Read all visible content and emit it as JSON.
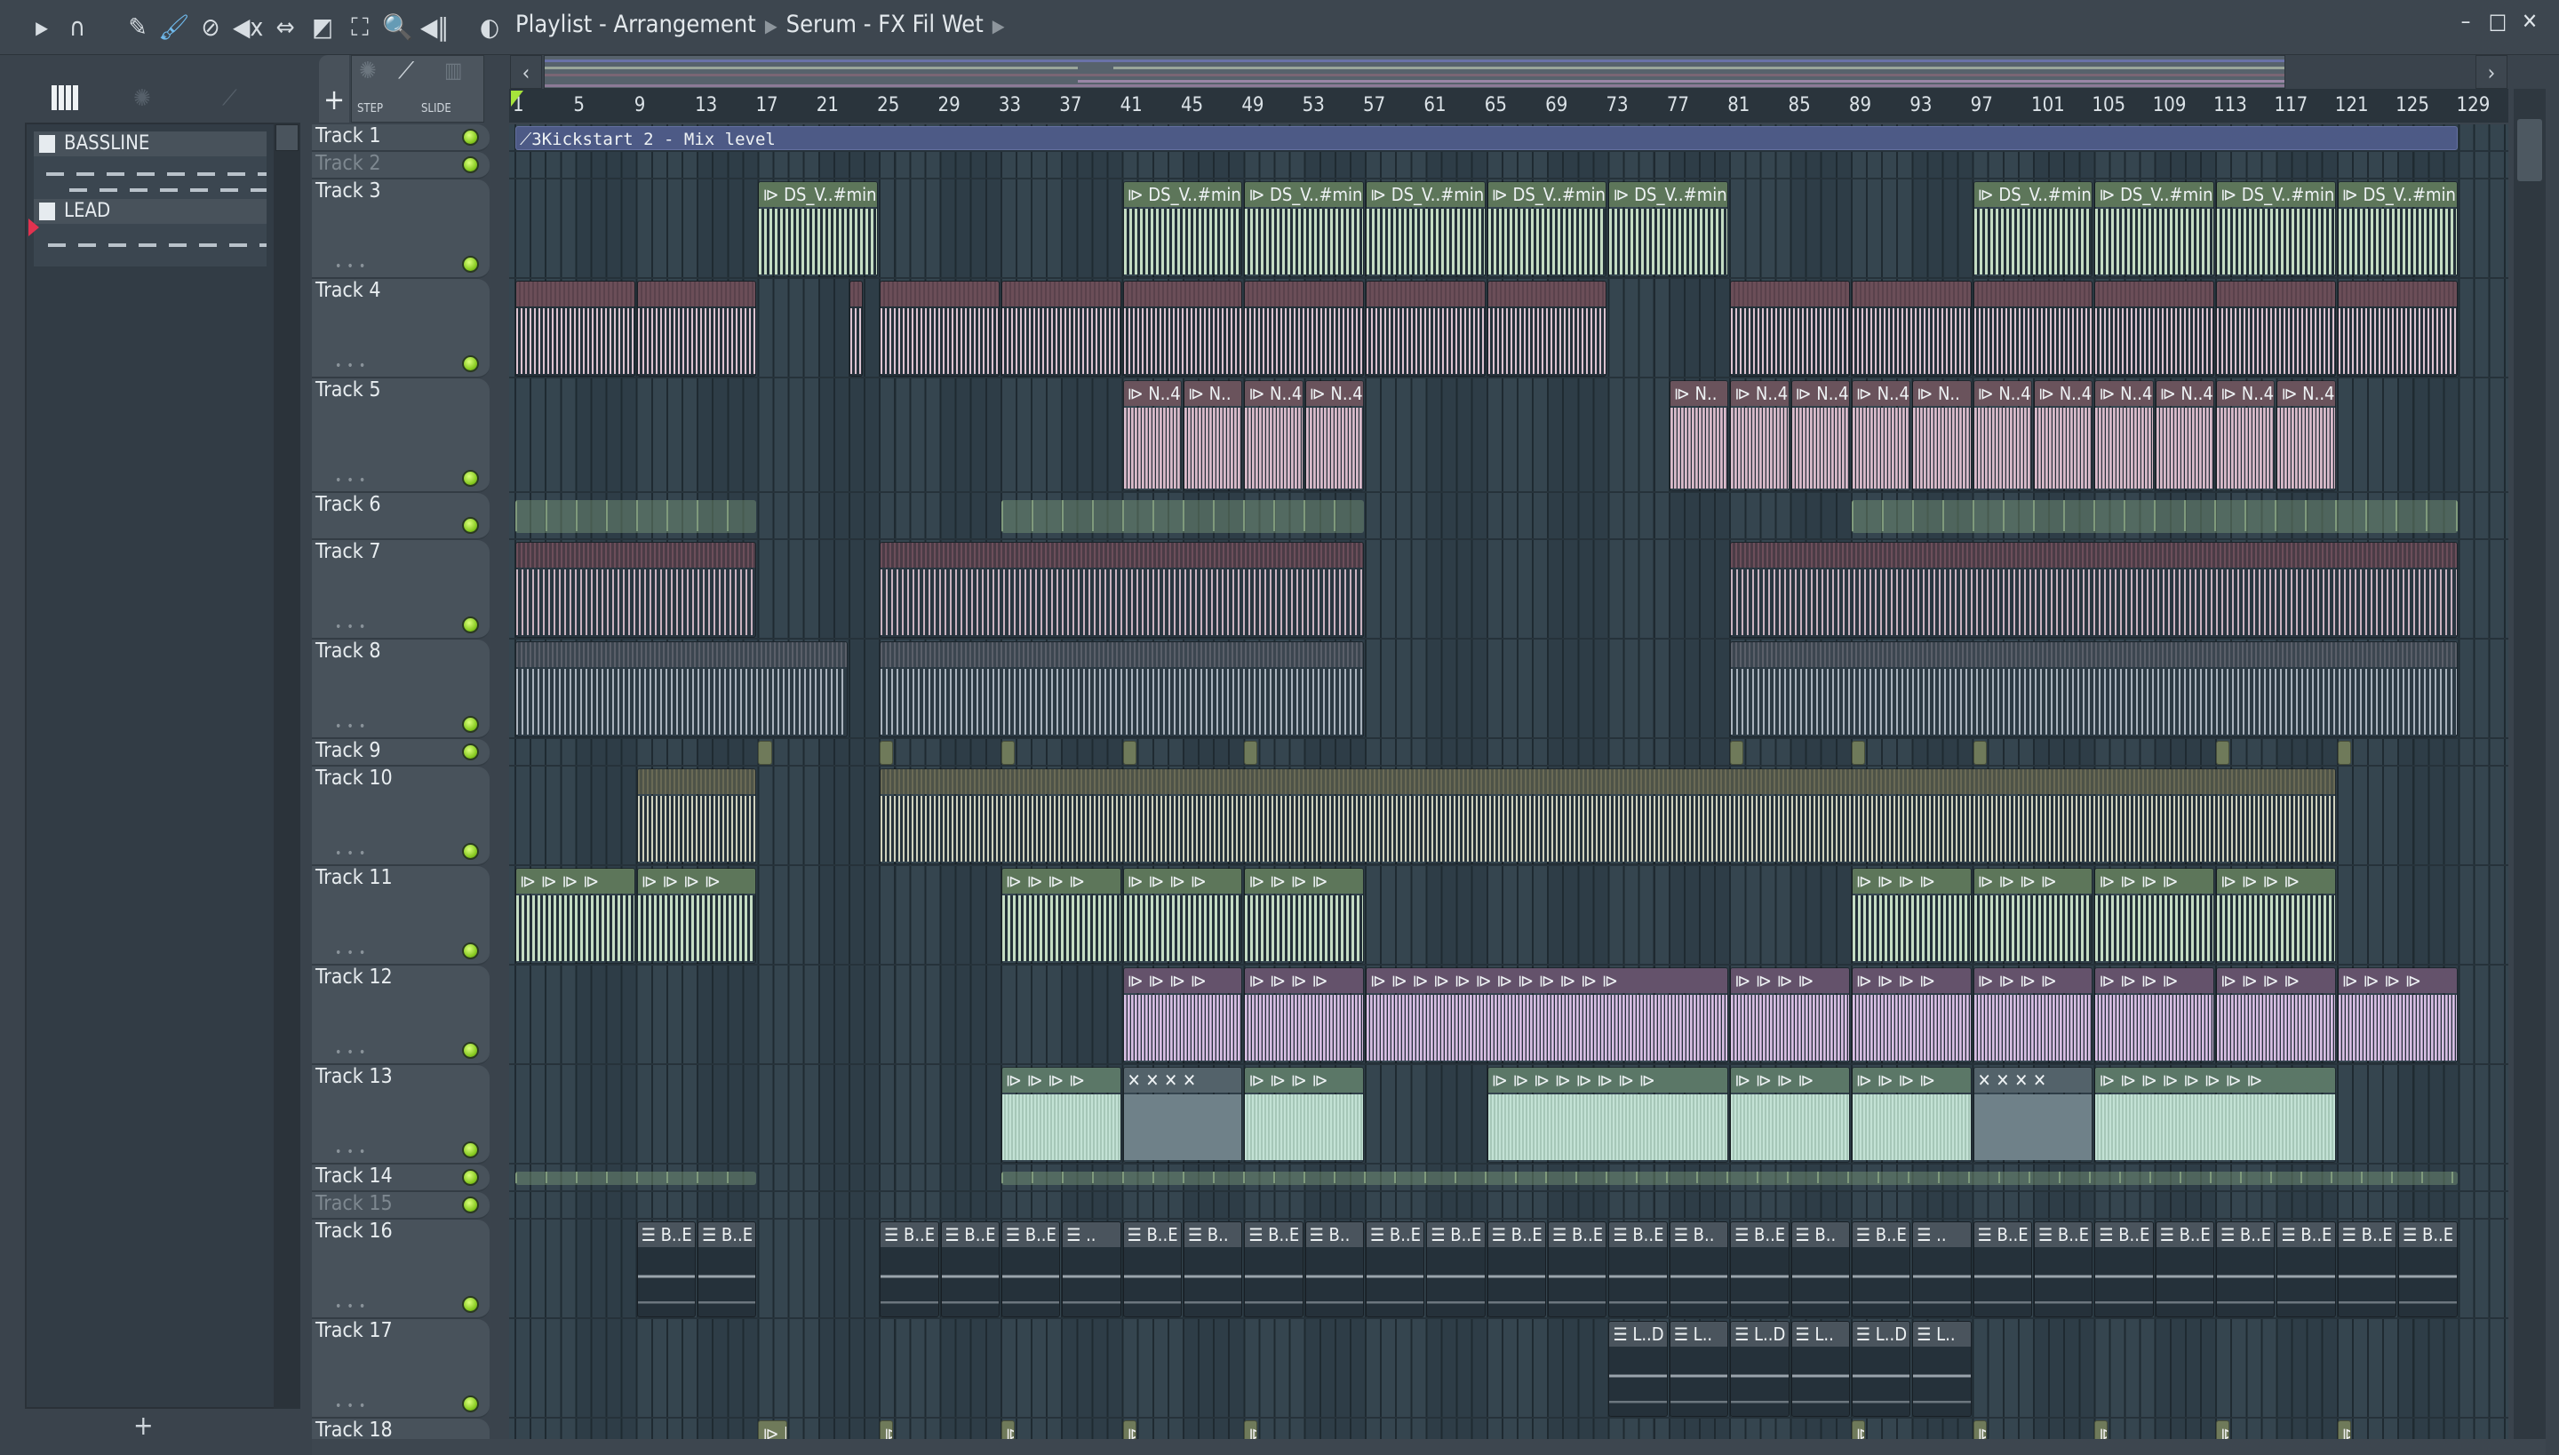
{
  "toolbar": {
    "icons": [
      "play-arrow-icon",
      "magnet-icon",
      "pencil-icon",
      "paint-brush-icon",
      "delete-icon",
      "mute-icon",
      "slip-icon",
      "slice-icon",
      "select-icon",
      "zoom-icon",
      "playback-icon"
    ],
    "speaker_icon": "speaker-icon",
    "breadcrumb": [
      "Playlist - Arrangement",
      "Serum - FX Fil Wet"
    ]
  },
  "window_controls": {
    "minimize": "–",
    "maximize": "□",
    "close": "✕"
  },
  "channel_panel": {
    "channels": [
      {
        "label": "BASSLINE"
      },
      {
        "label": "LEAD"
      }
    ],
    "add_label": "+"
  },
  "playlist_tools": {
    "add_label": "+",
    "step_label": "STEP",
    "slide_label": "SLIDE"
  },
  "ruler": {
    "labels": [
      "1",
      "5",
      "9",
      "13",
      "17",
      "21",
      "25",
      "29",
      "33",
      "37",
      "41",
      "45",
      "49",
      "53",
      "57",
      "61",
      "65",
      "69",
      "73",
      "77",
      "81",
      "85",
      "89",
      "93",
      "97",
      "101",
      "105",
      "109",
      "113",
      "117",
      "121",
      "125",
      "129",
      "1"
    ]
  },
  "tracks": [
    {
      "name": "Track 1"
    },
    {
      "name": "Track 2",
      "muted": true
    },
    {
      "name": "Track 3"
    },
    {
      "name": "Track 4"
    },
    {
      "name": "Track 5"
    },
    {
      "name": "Track 6"
    },
    {
      "name": "Track 7"
    },
    {
      "name": "Track 8"
    },
    {
      "name": "Track 9"
    },
    {
      "name": "Track 10"
    },
    {
      "name": "Track 11"
    },
    {
      "name": "Track 12"
    },
    {
      "name": "Track 13"
    },
    {
      "name": "Track 14"
    },
    {
      "name": "Track 15",
      "muted": true
    },
    {
      "name": "Track 16"
    },
    {
      "name": "Track 17"
    },
    {
      "name": "Track 18"
    }
  ],
  "clips": [
    {
      "track": 1,
      "start": 1,
      "len": 128,
      "label": "⟋3Kickstart 2 - Mix level",
      "style": "auto"
    },
    {
      "track": 3,
      "start": 17,
      "len": 8,
      "label": "⧐ DS_V..#min",
      "style": "green"
    },
    {
      "track": 3,
      "start": 41,
      "len": 8,
      "label": "⧐ DS_V..#min",
      "style": "green"
    },
    {
      "track": 3,
      "start": 49,
      "len": 8,
      "label": "⧐ DS_V..#min",
      "style": "green"
    },
    {
      "track": 3,
      "start": 57,
      "len": 8,
      "label": "⧐ DS_V..#min",
      "style": "green"
    },
    {
      "track": 3,
      "start": 65,
      "len": 8,
      "label": "⧐ DS_V..#min",
      "style": "green"
    },
    {
      "track": 3,
      "start": 73,
      "len": 8,
      "label": "⧐ DS_V..#min",
      "style": "green"
    },
    {
      "track": 3,
      "start": 97,
      "len": 8,
      "label": "⧐ DS_V..#min",
      "style": "green"
    },
    {
      "track": 3,
      "start": 105,
      "len": 8,
      "label": "⧐ DS_V..#min",
      "style": "green"
    },
    {
      "track": 3,
      "start": 113,
      "len": 8,
      "label": "⧐ DS_V..#min",
      "style": "green"
    },
    {
      "track": 3,
      "start": 121,
      "len": 8,
      "label": "⧐ DS_V..#min",
      "style": "green"
    },
    {
      "track": 4,
      "start": 1,
      "len": 8,
      "label": "",
      "style": "pink"
    },
    {
      "track": 4,
      "start": 9,
      "len": 8,
      "label": "",
      "style": "pink"
    },
    {
      "track": 4,
      "start": 23,
      "len": 1,
      "label": "",
      "style": "pink"
    },
    {
      "track": 4,
      "start": 25,
      "len": 8,
      "label": "",
      "style": "pink"
    },
    {
      "track": 4,
      "start": 33,
      "len": 8,
      "label": "",
      "style": "pink"
    },
    {
      "track": 4,
      "start": 41,
      "len": 8,
      "label": "",
      "style": "pink"
    },
    {
      "track": 4,
      "start": 49,
      "len": 8,
      "label": "",
      "style": "pink"
    },
    {
      "track": 4,
      "start": 57,
      "len": 8,
      "label": "",
      "style": "pink"
    },
    {
      "track": 4,
      "start": 65,
      "len": 8,
      "label": "",
      "style": "pink"
    },
    {
      "track": 4,
      "start": 81,
      "len": 8,
      "label": "",
      "style": "pink"
    },
    {
      "track": 4,
      "start": 89,
      "len": 8,
      "label": "",
      "style": "pink"
    },
    {
      "track": 4,
      "start": 97,
      "len": 8,
      "label": "",
      "style": "pink"
    },
    {
      "track": 4,
      "start": 105,
      "len": 8,
      "label": "",
      "style": "pink"
    },
    {
      "track": 4,
      "start": 113,
      "len": 8,
      "label": "",
      "style": "pink"
    },
    {
      "track": 4,
      "start": 121,
      "len": 8,
      "label": "",
      "style": "pink"
    },
    {
      "track": 5,
      "start": 41,
      "len": 4,
      "label": "⧐ N..4",
      "style": "npink"
    },
    {
      "track": 5,
      "start": 45,
      "len": 4,
      "label": "⧐ N..",
      "style": "npink"
    },
    {
      "track": 5,
      "start": 49,
      "len": 4,
      "label": "⧐ N..4",
      "style": "npink"
    },
    {
      "track": 5,
      "start": 53,
      "len": 4,
      "label": "⧐ N..4",
      "style": "npink"
    },
    {
      "track": 5,
      "start": 77,
      "len": 4,
      "label": "⧐ N..",
      "style": "npink"
    },
    {
      "track": 5,
      "start": 81,
      "len": 4,
      "label": "⧐ N..4",
      "style": "npink"
    },
    {
      "track": 5,
      "start": 85,
      "len": 4,
      "label": "⧐ N..4",
      "style": "npink"
    },
    {
      "track": 5,
      "start": 89,
      "len": 4,
      "label": "⧐ N..4",
      "style": "npink"
    },
    {
      "track": 5,
      "start": 93,
      "len": 4,
      "label": "⧐ N..",
      "style": "npink"
    },
    {
      "track": 5,
      "start": 97,
      "len": 4,
      "label": "⧐ N..4",
      "style": "npink"
    },
    {
      "track": 5,
      "start": 101,
      "len": 4,
      "label": "⧐ N..4",
      "style": "npink"
    },
    {
      "track": 5,
      "start": 105,
      "len": 4,
      "label": "⧐ N..4",
      "style": "npink"
    },
    {
      "track": 5,
      "start": 109,
      "len": 4,
      "label": "⧐ N..4",
      "style": "npink"
    },
    {
      "track": 5,
      "start": 113,
      "len": 4,
      "label": "⧐ N..4",
      "style": "npink"
    },
    {
      "track": 5,
      "start": 117,
      "len": 4,
      "label": "⧐ N..4",
      "style": "npink"
    },
    {
      "track": 6,
      "start": 1,
      "len": 16,
      "label": "",
      "style": "tick"
    },
    {
      "track": 6,
      "start": 33,
      "len": 24,
      "label": "",
      "style": "tick"
    },
    {
      "track": 6,
      "start": 89,
      "len": 40,
      "label": "",
      "style": "tick"
    },
    {
      "track": 7,
      "start": 1,
      "len": 16,
      "label": "",
      "style": "stripe"
    },
    {
      "track": 7,
      "start": 25,
      "len": 32,
      "label": "",
      "style": "stripe"
    },
    {
      "track": 7,
      "start": 81,
      "len": 48,
      "label": "",
      "style": "stripe"
    },
    {
      "track": 8,
      "start": 1,
      "len": 22,
      "label": "",
      "style": "gray"
    },
    {
      "track": 8,
      "start": 25,
      "len": 32,
      "label": "",
      "style": "gray"
    },
    {
      "track": 8,
      "start": 81,
      "len": 48,
      "label": "",
      "style": "gray"
    },
    {
      "track": 9,
      "start": 17,
      "len": 1,
      "label": "",
      "style": "mark"
    },
    {
      "track": 9,
      "start": 25,
      "len": 1,
      "label": "",
      "style": "mark"
    },
    {
      "track": 9,
      "start": 33,
      "len": 1,
      "label": "",
      "style": "mark"
    },
    {
      "track": 9,
      "start": 41,
      "len": 1,
      "label": "",
      "style": "mark"
    },
    {
      "track": 9,
      "start": 49,
      "len": 1,
      "label": "",
      "style": "mark"
    },
    {
      "track": 9,
      "start": 81,
      "len": 1,
      "label": "",
      "style": "mark"
    },
    {
      "track": 9,
      "start": 89,
      "len": 1,
      "label": "",
      "style": "mark"
    },
    {
      "track": 9,
      "start": 97,
      "len": 1,
      "label": "",
      "style": "mark"
    },
    {
      "track": 9,
      "start": 113,
      "len": 1,
      "label": "",
      "style": "mark"
    },
    {
      "track": 9,
      "start": 121,
      "len": 1,
      "label": "",
      "style": "mark"
    },
    {
      "track": 10,
      "start": 9,
      "len": 8,
      "label": "",
      "style": "olive"
    },
    {
      "track": 10,
      "start": 25,
      "len": 96,
      "label": "",
      "style": "olive"
    },
    {
      "track": 11,
      "start": 1,
      "len": 8,
      "label": "⧐ ⧐ ⧐ ⧐",
      "style": "green"
    },
    {
      "track": 11,
      "start": 9,
      "len": 8,
      "label": "⧐ ⧐ ⧐ ⧐",
      "style": "green"
    },
    {
      "track": 11,
      "start": 33,
      "len": 8,
      "label": "⧐ ⧐ ⧐ ⧐",
      "style": "green"
    },
    {
      "track": 11,
      "start": 41,
      "len": 8,
      "label": "⧐ ⧐ ⧐ ⧐",
      "style": "green"
    },
    {
      "track": 11,
      "start": 49,
      "len": 8,
      "label": "⧐ ⧐ ⧐ ⧐",
      "style": "green"
    },
    {
      "track": 11,
      "start": 89,
      "len": 8,
      "label": "⧐ ⧐ ⧐ ⧐",
      "style": "green"
    },
    {
      "track": 11,
      "start": 97,
      "len": 8,
      "label": "⧐ ⧐ ⧐ ⧐",
      "style": "green"
    },
    {
      "track": 11,
      "start": 105,
      "len": 8,
      "label": "⧐ ⧐ ⧐ ⧐",
      "style": "green"
    },
    {
      "track": 11,
      "start": 113,
      "len": 8,
      "label": "⧐ ⧐ ⧐ ⧐",
      "style": "green"
    },
    {
      "track": 12,
      "start": 41,
      "len": 8,
      "label": "⧐ ⧐ ⧐ ⧐",
      "style": "purple"
    },
    {
      "track": 12,
      "start": 49,
      "len": 8,
      "label": "⧐ ⧐ ⧐ ⧐",
      "style": "purple"
    },
    {
      "track": 12,
      "start": 57,
      "len": 24,
      "label": "⧐ ⧐ ⧐ ⧐ ⧐ ⧐ ⧐ ⧐ ⧐ ⧐ ⧐ ⧐",
      "style": "purple"
    },
    {
      "track": 12,
      "start": 81,
      "len": 8,
      "label": "⧐ ⧐ ⧐ ⧐",
      "style": "purple"
    },
    {
      "track": 12,
      "start": 89,
      "len": 8,
      "label": "⧐ ⧐ ⧐ ⧐",
      "style": "purple"
    },
    {
      "track": 12,
      "start": 97,
      "len": 8,
      "label": "⧐ ⧐ ⧐ ⧐",
      "style": "purple"
    },
    {
      "track": 12,
      "start": 105,
      "len": 8,
      "label": "⧐ ⧐ ⧐ ⧐",
      "style": "purple"
    },
    {
      "track": 12,
      "start": 113,
      "len": 8,
      "label": "⧐ ⧐ ⧐ ⧐",
      "style": "purple"
    },
    {
      "track": 12,
      "start": 121,
      "len": 8,
      "label": "⧐ ⧐ ⧐ ⧐",
      "style": "purple"
    },
    {
      "track": 13,
      "start": 33,
      "len": 8,
      "label": "⧐ ⧐ ⧐ ⧐",
      "style": "teal"
    },
    {
      "track": 13,
      "start": 41,
      "len": 8,
      "label": "✕ ✕ ✕ ✕",
      "style": "tealx"
    },
    {
      "track": 13,
      "start": 49,
      "len": 8,
      "label": "⧐ ⧐ ⧐ ⧐",
      "style": "teal"
    },
    {
      "track": 13,
      "start": 65,
      "len": 16,
      "label": "⧐ ⧐ ⧐ ⧐ ⧐ ⧐ ⧐ ⧐",
      "style": "teal"
    },
    {
      "track": 13,
      "start": 81,
      "len": 8,
      "label": "⧐ ⧐ ⧐ ⧐",
      "style": "teal"
    },
    {
      "track": 13,
      "start": 89,
      "len": 8,
      "label": "⧐ ⧐ ⧐ ⧐",
      "style": "teal"
    },
    {
      "track": 13,
      "start": 97,
      "len": 8,
      "label": "✕ ✕ ✕ ✕",
      "style": "tealx"
    },
    {
      "track": 13,
      "start": 105,
      "len": 16,
      "label": "⧐ ⧐ ⧐ ⧐ ⧐ ⧐ ⧐ ⧐",
      "style": "teal"
    },
    {
      "track": 14,
      "start": 1,
      "len": 16,
      "label": "",
      "style": "tick"
    },
    {
      "track": 14,
      "start": 33,
      "len": 96,
      "label": "",
      "style": "tick"
    },
    {
      "track": 16,
      "start": 9,
      "len": 4,
      "label": "☰ B..E",
      "style": "pat"
    },
    {
      "track": 16,
      "start": 13,
      "len": 4,
      "label": "☰ B..E",
      "style": "pat"
    },
    {
      "track": 16,
      "start": 25,
      "len": 4,
      "label": "☰ B..E",
      "style": "pat"
    },
    {
      "track": 16,
      "start": 29,
      "len": 4,
      "label": "☰ B..E",
      "style": "pat"
    },
    {
      "track": 16,
      "start": 33,
      "len": 4,
      "label": "☰ B..E",
      "style": "pat"
    },
    {
      "track": 16,
      "start": 37,
      "len": 4,
      "label": "☰ ..",
      "style": "pat"
    },
    {
      "track": 16,
      "start": 41,
      "len": 4,
      "label": "☰ B..E",
      "style": "pat"
    },
    {
      "track": 16,
      "start": 45,
      "len": 4,
      "label": "☰ B..",
      "style": "pat"
    },
    {
      "track": 16,
      "start": 49,
      "len": 4,
      "label": "☰ B..E",
      "style": "pat"
    },
    {
      "track": 16,
      "start": 53,
      "len": 4,
      "label": "☰ B..",
      "style": "pat"
    },
    {
      "track": 16,
      "start": 57,
      "len": 4,
      "label": "☰ B..E",
      "style": "pat"
    },
    {
      "track": 16,
      "start": 61,
      "len": 4,
      "label": "☰ B..E",
      "style": "pat"
    },
    {
      "track": 16,
      "start": 65,
      "len": 4,
      "label": "☰ B..E",
      "style": "pat"
    },
    {
      "track": 16,
      "start": 69,
      "len": 4,
      "label": "☰ B..E",
      "style": "pat"
    },
    {
      "track": 16,
      "start": 73,
      "len": 4,
      "label": "☰ B..E",
      "style": "pat"
    },
    {
      "track": 16,
      "start": 77,
      "len": 4,
      "label": "☰ B..",
      "style": "pat"
    },
    {
      "track": 16,
      "start": 81,
      "len": 4,
      "label": "☰ B..E",
      "style": "pat"
    },
    {
      "track": 16,
      "start": 85,
      "len": 4,
      "label": "☰ B..",
      "style": "pat"
    },
    {
      "track": 16,
      "start": 89,
      "len": 4,
      "label": "☰ B..E",
      "style": "pat"
    },
    {
      "track": 16,
      "start": 93,
      "len": 4,
      "label": "☰ ..",
      "style": "pat"
    },
    {
      "track": 16,
      "start": 97,
      "len": 4,
      "label": "☰ B..E",
      "style": "pat"
    },
    {
      "track": 16,
      "start": 101,
      "len": 4,
      "label": "☰ B..E",
      "style": "pat"
    },
    {
      "track": 16,
      "start": 105,
      "len": 4,
      "label": "☰ B..E",
      "style": "pat"
    },
    {
      "track": 16,
      "start": 109,
      "len": 4,
      "label": "☰ B..E",
      "style": "pat"
    },
    {
      "track": 16,
      "start": 113,
      "len": 4,
      "label": "☰ B..E",
      "style": "pat"
    },
    {
      "track": 16,
      "start": 117,
      "len": 4,
      "label": "☰ B..E",
      "style": "pat"
    },
    {
      "track": 16,
      "start": 121,
      "len": 4,
      "label": "☰ B..E",
      "style": "pat"
    },
    {
      "track": 16,
      "start": 125,
      "len": 4,
      "label": "☰ B..E",
      "style": "pat"
    },
    {
      "track": 17,
      "start": 73,
      "len": 4,
      "label": "☰ L..D",
      "style": "pat"
    },
    {
      "track": 17,
      "start": 77,
      "len": 4,
      "label": "☰ L..",
      "style": "pat"
    },
    {
      "track": 17,
      "start": 81,
      "len": 4,
      "label": "☰ L..D",
      "style": "pat"
    },
    {
      "track": 17,
      "start": 85,
      "len": 4,
      "label": "☰ L..",
      "style": "pat"
    },
    {
      "track": 17,
      "start": 89,
      "len": 4,
      "label": "☰ L..D",
      "style": "pat"
    },
    {
      "track": 17,
      "start": 93,
      "len": 4,
      "label": "☰ L..",
      "style": "pat"
    },
    {
      "track": 18,
      "start": 17,
      "len": 2,
      "label": "⧐ L..id",
      "style": "mark"
    },
    {
      "track": 18,
      "start": 25,
      "len": 1,
      "label": "⧐",
      "style": "mark"
    },
    {
      "track": 18,
      "start": 33,
      "len": 1,
      "label": "⧐",
      "style": "mark"
    },
    {
      "track": 18,
      "start": 41,
      "len": 1,
      "label": "⧐",
      "style": "mark"
    },
    {
      "track": 18,
      "start": 49,
      "len": 1,
      "label": "⧐",
      "style": "mark"
    },
    {
      "track": 18,
      "start": 89,
      "len": 1,
      "label": "⧐",
      "style": "mark"
    },
    {
      "track": 18,
      "start": 97,
      "len": 1,
      "label": "⧐",
      "style": "mark"
    },
    {
      "track": 18,
      "start": 105,
      "len": 1,
      "label": "⧐",
      "style": "mark"
    },
    {
      "track": 18,
      "start": 113,
      "len": 1,
      "label": "⧐",
      "style": "mark"
    },
    {
      "track": 18,
      "start": 121,
      "len": 1,
      "label": "⧐",
      "style": "mark"
    }
  ]
}
